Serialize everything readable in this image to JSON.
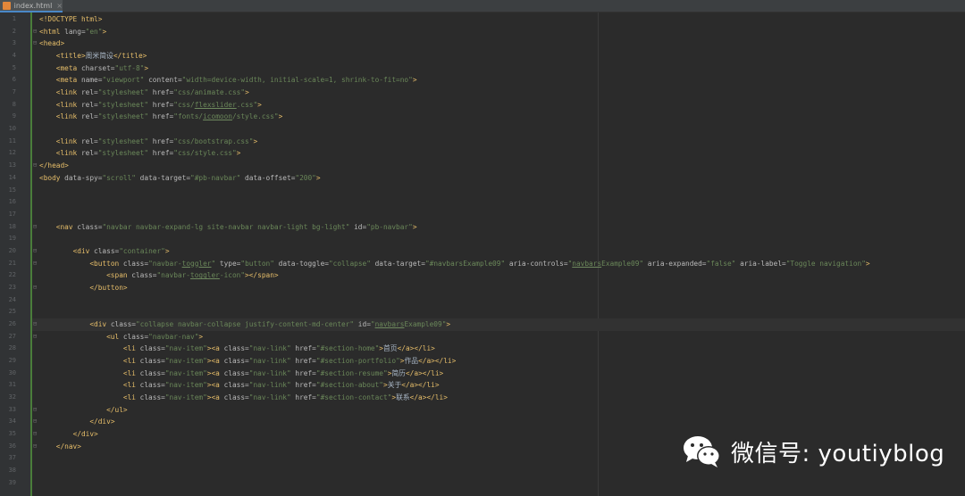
{
  "tab": {
    "label": "index.html",
    "close": "×"
  },
  "line_numbers": [
    "1",
    "2",
    "3",
    "4",
    "5",
    "6",
    "7",
    "8",
    "9",
    "10",
    "11",
    "12",
    "13",
    "14",
    "15",
    "16",
    "17",
    "18",
    "19",
    "20",
    "21",
    "22",
    "23",
    "24",
    "25",
    "26",
    "27",
    "28",
    "29",
    "30",
    "31",
    "32",
    "33",
    "34",
    "35",
    "36",
    "37",
    "38",
    "39"
  ],
  "code_lines": [
    [
      {
        "c": "doctype",
        "t": "<!DOCTYPE html>"
      }
    ],
    [
      {
        "c": "tag",
        "t": "<html "
      },
      {
        "c": "attr",
        "t": "lang="
      },
      {
        "c": "val",
        "t": "\"en\""
      },
      {
        "c": "tag",
        "t": ">"
      }
    ],
    [
      {
        "c": "tag",
        "t": "<head>"
      }
    ],
    [
      {
        "c": "txt",
        "t": "    "
      },
      {
        "c": "tag",
        "t": "<title>"
      },
      {
        "c": "txt",
        "t": "周米简设"
      },
      {
        "c": "tag",
        "t": "</title>"
      }
    ],
    [
      {
        "c": "txt",
        "t": "    "
      },
      {
        "c": "tag",
        "t": "<meta "
      },
      {
        "c": "attr",
        "t": "charset="
      },
      {
        "c": "val",
        "t": "\"utf-8\""
      },
      {
        "c": "tag",
        "t": ">"
      }
    ],
    [
      {
        "c": "txt",
        "t": "    "
      },
      {
        "c": "tag",
        "t": "<meta "
      },
      {
        "c": "attr",
        "t": "name="
      },
      {
        "c": "val",
        "t": "\"viewport\""
      },
      {
        "c": "attr",
        "t": " content="
      },
      {
        "c": "val",
        "t": "\"width=device-width, initial-scale=1, shrink-to-fit=no\""
      },
      {
        "c": "tag",
        "t": ">"
      }
    ],
    [
      {
        "c": "txt",
        "t": "    "
      },
      {
        "c": "tag",
        "t": "<link "
      },
      {
        "c": "attr",
        "t": "rel="
      },
      {
        "c": "val",
        "t": "\"stylesheet\""
      },
      {
        "c": "attr",
        "t": " href="
      },
      {
        "c": "val",
        "t": "\"css/animate.css\""
      },
      {
        "c": "tag",
        "t": ">"
      }
    ],
    [
      {
        "c": "txt",
        "t": "    "
      },
      {
        "c": "tag",
        "t": "<link "
      },
      {
        "c": "attr",
        "t": "rel="
      },
      {
        "c": "val",
        "t": "\"stylesheet\""
      },
      {
        "c": "attr",
        "t": " href="
      },
      {
        "c": "val",
        "t": "\"css/"
      },
      {
        "c": "val under",
        "t": "flexslider"
      },
      {
        "c": "val",
        "t": ".css\""
      },
      {
        "c": "tag",
        "t": ">"
      }
    ],
    [
      {
        "c": "txt",
        "t": "    "
      },
      {
        "c": "tag",
        "t": "<link "
      },
      {
        "c": "attr",
        "t": "rel="
      },
      {
        "c": "val",
        "t": "\"stylesheet\""
      },
      {
        "c": "attr",
        "t": " href="
      },
      {
        "c": "val",
        "t": "\"fonts/"
      },
      {
        "c": "val under",
        "t": "icomoon"
      },
      {
        "c": "val",
        "t": "/style.css\""
      },
      {
        "c": "tag",
        "t": ">"
      }
    ],
    [],
    [
      {
        "c": "txt",
        "t": "    "
      },
      {
        "c": "tag",
        "t": "<link "
      },
      {
        "c": "attr",
        "t": "rel="
      },
      {
        "c": "val",
        "t": "\"stylesheet\""
      },
      {
        "c": "attr",
        "t": " href="
      },
      {
        "c": "val",
        "t": "\"css/bootstrap.css\""
      },
      {
        "c": "tag",
        "t": ">"
      }
    ],
    [
      {
        "c": "txt",
        "t": "    "
      },
      {
        "c": "tag",
        "t": "<link "
      },
      {
        "c": "attr",
        "t": "rel="
      },
      {
        "c": "val",
        "t": "\"stylesheet\""
      },
      {
        "c": "attr",
        "t": " href="
      },
      {
        "c": "val",
        "t": "\"css/style.css\""
      },
      {
        "c": "tag",
        "t": ">"
      }
    ],
    [
      {
        "c": "tag",
        "t": "</head>"
      }
    ],
    [
      {
        "c": "tag",
        "t": "<body "
      },
      {
        "c": "attr",
        "t": "data-spy="
      },
      {
        "c": "val",
        "t": "\"scroll\""
      },
      {
        "c": "attr",
        "t": " data-target="
      },
      {
        "c": "val",
        "t": "\"#pb-navbar\""
      },
      {
        "c": "attr",
        "t": " data-offset="
      },
      {
        "c": "val",
        "t": "\"200\""
      },
      {
        "c": "tag",
        "t": ">"
      }
    ],
    [],
    [],
    [],
    [
      {
        "c": "txt",
        "t": "    "
      },
      {
        "c": "tag",
        "t": "<nav "
      },
      {
        "c": "attr",
        "t": "class="
      },
      {
        "c": "val",
        "t": "\"navbar navbar-expand-lg site-navbar navbar-light bg-light\""
      },
      {
        "c": "attr",
        "t": " id="
      },
      {
        "c": "val",
        "t": "\"pb-navbar\""
      },
      {
        "c": "tag",
        "t": ">"
      }
    ],
    [],
    [
      {
        "c": "txt",
        "t": "        "
      },
      {
        "c": "tag",
        "t": "<div "
      },
      {
        "c": "attr",
        "t": "class="
      },
      {
        "c": "val",
        "t": "\"container\""
      },
      {
        "c": "tag",
        "t": ">"
      }
    ],
    [
      {
        "c": "txt",
        "t": "            "
      },
      {
        "c": "tag",
        "t": "<button "
      },
      {
        "c": "attr",
        "t": "class="
      },
      {
        "c": "val",
        "t": "\"navbar-"
      },
      {
        "c": "val under",
        "t": "toggler"
      },
      {
        "c": "val",
        "t": "\""
      },
      {
        "c": "attr",
        "t": " type="
      },
      {
        "c": "val",
        "t": "\"button\""
      },
      {
        "c": "attr",
        "t": " data-toggle="
      },
      {
        "c": "val",
        "t": "\"collapse\""
      },
      {
        "c": "attr",
        "t": " data-target="
      },
      {
        "c": "val",
        "t": "\"#navbarsExample09\""
      },
      {
        "c": "attr",
        "t": " aria-controls="
      },
      {
        "c": "val",
        "t": "\""
      },
      {
        "c": "val under",
        "t": "navbars"
      },
      {
        "c": "val",
        "t": "Example09\""
      },
      {
        "c": "attr",
        "t": " aria-expanded="
      },
      {
        "c": "val",
        "t": "\"false\""
      },
      {
        "c": "attr",
        "t": " aria-label="
      },
      {
        "c": "val",
        "t": "\"Toggle navigation\""
      },
      {
        "c": "tag",
        "t": ">"
      }
    ],
    [
      {
        "c": "txt",
        "t": "                "
      },
      {
        "c": "tag",
        "t": "<span "
      },
      {
        "c": "attr",
        "t": "class="
      },
      {
        "c": "val",
        "t": "\"navbar-"
      },
      {
        "c": "val under",
        "t": "toggler"
      },
      {
        "c": "val",
        "t": "-icon\""
      },
      {
        "c": "tag",
        "t": "></span>"
      }
    ],
    [
      {
        "c": "txt",
        "t": "            "
      },
      {
        "c": "tag",
        "t": "</button>"
      }
    ],
    [],
    [],
    [
      {
        "c": "txt",
        "t": "            "
      },
      {
        "c": "tag",
        "t": "<div "
      },
      {
        "c": "attr",
        "t": "class="
      },
      {
        "c": "val",
        "t": "\"collapse navbar-collapse justify-content-md-center\""
      },
      {
        "c": "attr",
        "t": " id="
      },
      {
        "c": "val",
        "t": "\""
      },
      {
        "c": "val under",
        "t": "navbars"
      },
      {
        "c": "val",
        "t": "Example09\""
      },
      {
        "c": "tag",
        "t": ">"
      }
    ],
    [
      {
        "c": "txt",
        "t": "                "
      },
      {
        "c": "tag",
        "t": "<ul "
      },
      {
        "c": "attr",
        "t": "class="
      },
      {
        "c": "val",
        "t": "\"navbar-nav\""
      },
      {
        "c": "tag",
        "t": ">"
      }
    ],
    [
      {
        "c": "txt",
        "t": "                    "
      },
      {
        "c": "tag",
        "t": "<li "
      },
      {
        "c": "attr",
        "t": "class="
      },
      {
        "c": "val",
        "t": "\"nav-item\""
      },
      {
        "c": "tag",
        "t": "><a "
      },
      {
        "c": "attr",
        "t": "class="
      },
      {
        "c": "val",
        "t": "\"nav-link\""
      },
      {
        "c": "attr",
        "t": " href="
      },
      {
        "c": "val",
        "t": "\"#section-home\""
      },
      {
        "c": "tag",
        "t": ">"
      },
      {
        "c": "txt",
        "t": "首页"
      },
      {
        "c": "tag",
        "t": "</a></li>"
      }
    ],
    [
      {
        "c": "txt",
        "t": "                    "
      },
      {
        "c": "tag",
        "t": "<li "
      },
      {
        "c": "attr",
        "t": "class="
      },
      {
        "c": "val",
        "t": "\"nav-item\""
      },
      {
        "c": "tag",
        "t": "><a "
      },
      {
        "c": "attr",
        "t": "class="
      },
      {
        "c": "val",
        "t": "\"nav-link\""
      },
      {
        "c": "attr",
        "t": " href="
      },
      {
        "c": "val",
        "t": "\"#section-portfolio\""
      },
      {
        "c": "tag",
        "t": ">"
      },
      {
        "c": "txt",
        "t": "作品"
      },
      {
        "c": "tag",
        "t": "</a></li>"
      }
    ],
    [
      {
        "c": "txt",
        "t": "                    "
      },
      {
        "c": "tag",
        "t": "<li "
      },
      {
        "c": "attr",
        "t": "class="
      },
      {
        "c": "val",
        "t": "\"nav-item\""
      },
      {
        "c": "tag",
        "t": "><a "
      },
      {
        "c": "attr",
        "t": "class="
      },
      {
        "c": "val",
        "t": "\"nav-link\""
      },
      {
        "c": "attr",
        "t": " href="
      },
      {
        "c": "val",
        "t": "\"#section-resume\""
      },
      {
        "c": "tag",
        "t": ">"
      },
      {
        "c": "txt",
        "t": "简历"
      },
      {
        "c": "tag",
        "t": "</a></li>"
      }
    ],
    [
      {
        "c": "txt",
        "t": "                    "
      },
      {
        "c": "tag",
        "t": "<li "
      },
      {
        "c": "attr",
        "t": "class="
      },
      {
        "c": "val",
        "t": "\"nav-item\""
      },
      {
        "c": "tag",
        "t": "><a "
      },
      {
        "c": "attr",
        "t": "class="
      },
      {
        "c": "val",
        "t": "\"nav-link\""
      },
      {
        "c": "attr",
        "t": " href="
      },
      {
        "c": "val",
        "t": "\"#section-about\""
      },
      {
        "c": "tag",
        "t": ">"
      },
      {
        "c": "txt",
        "t": "关于"
      },
      {
        "c": "tag",
        "t": "</a></li>"
      }
    ],
    [
      {
        "c": "txt",
        "t": "                    "
      },
      {
        "c": "tag",
        "t": "<li "
      },
      {
        "c": "attr",
        "t": "class="
      },
      {
        "c": "val",
        "t": "\"nav-item\""
      },
      {
        "c": "tag",
        "t": "><a "
      },
      {
        "c": "attr",
        "t": "class="
      },
      {
        "c": "val",
        "t": "\"nav-link\""
      },
      {
        "c": "attr",
        "t": " href="
      },
      {
        "c": "val",
        "t": "\"#section-contact\""
      },
      {
        "c": "tag",
        "t": ">"
      },
      {
        "c": "txt",
        "t": "联系"
      },
      {
        "c": "tag",
        "t": "</a></li>"
      }
    ],
    [
      {
        "c": "txt",
        "t": "                "
      },
      {
        "c": "tag",
        "t": "</ul>"
      }
    ],
    [
      {
        "c": "txt",
        "t": "            "
      },
      {
        "c": "tag",
        "t": "</div>"
      }
    ],
    [
      {
        "c": "txt",
        "t": "        "
      },
      {
        "c": "tag",
        "t": "</div>"
      }
    ],
    [
      {
        "c": "txt",
        "t": "    "
      },
      {
        "c": "tag",
        "t": "</nav>"
      }
    ],
    [],
    [],
    [],
    []
  ],
  "current_line_index": 25,
  "watermark": {
    "text": "微信号: youtiyblog",
    "icon": "wechat-icon"
  },
  "colors": {
    "bg": "#2b2b2b",
    "tag": "#e8bf6a",
    "attr": "#bababa",
    "value": "#6a8759",
    "text": "#a9b7c6",
    "gutter": "#313335"
  }
}
